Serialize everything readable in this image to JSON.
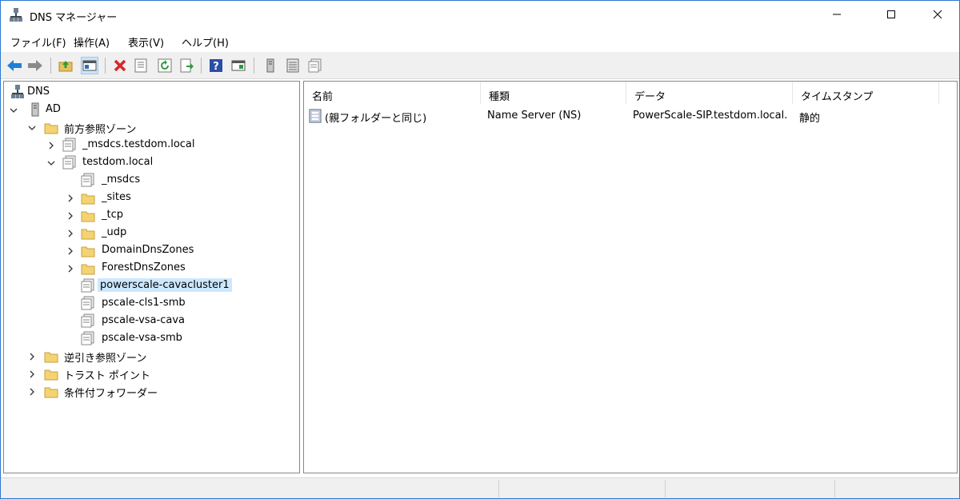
{
  "window": {
    "title": "DNS マネージャー"
  },
  "menu": {
    "items": [
      "ファイル(F)",
      "操作(A)",
      "表示(V)",
      "ヘルプ(H)"
    ]
  },
  "toolbar": {
    "buttons": [
      "back-icon",
      "forward-icon",
      "up-folder-icon",
      "show-hide-console-tree-icon",
      "delete-icon",
      "properties-icon",
      "refresh-icon",
      "export-list-icon",
      "help-icon",
      "show-hide-action-pane-icon",
      "server-icon",
      "list-icon",
      "zone-icon"
    ]
  },
  "tree": {
    "root": "DNS",
    "server": "AD",
    "forward_zones": "前方参照ゾーン",
    "msdcs_zone": "_msdcs.testdom.local",
    "testdom_zone": "testdom.local",
    "children": [
      "_msdcs",
      "_sites",
      "_tcp",
      "_udp",
      "DomainDnsZones",
      "ForestDnsZones",
      "powerscale-cavacluster1",
      "pscale-cls1-smb",
      "pscale-vsa-cava",
      "pscale-vsa-smb"
    ],
    "reverse_zones": "逆引き参照ゾーン",
    "trust_points": "トラスト ポイント",
    "conditional_forwarders": "条件付フォワーダー"
  },
  "list": {
    "columns": [
      "名前",
      "種類",
      "データ",
      "タイムスタンプ"
    ],
    "rows": [
      {
        "name": "(親フォルダーと同じ)",
        "type": "Name Server (NS)",
        "data": "PowerScale-SIP.testdom.local.",
        "timestamp": "静的"
      }
    ]
  },
  "colors": {
    "selection": "#cce8ff",
    "window_border": "#2b79d0",
    "delete_red": "#d9242b",
    "back_blue": "#1e7fd8"
  }
}
